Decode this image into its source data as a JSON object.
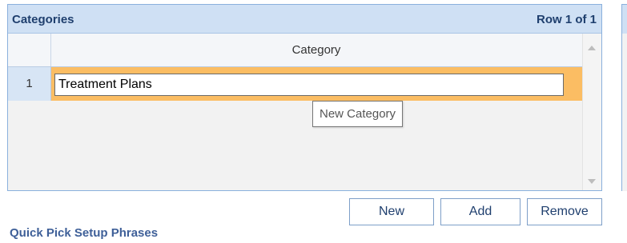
{
  "panel": {
    "title": "Categories",
    "row_info": "Row 1 of 1"
  },
  "grid": {
    "columns": [
      "Category"
    ],
    "rows": [
      {
        "num": "1",
        "category": "Treatment Plans"
      }
    ]
  },
  "tooltip": {
    "text": "New Category"
  },
  "buttons": {
    "new_label": "New",
    "add_label": "Add",
    "remove_label": "Remove"
  },
  "section": {
    "title": "Quick Pick Setup Phrases"
  },
  "colors": {
    "selected_row": "#fbbd63",
    "header_bg": "#cfe0f4",
    "accent_text": "#1f3f6e"
  }
}
